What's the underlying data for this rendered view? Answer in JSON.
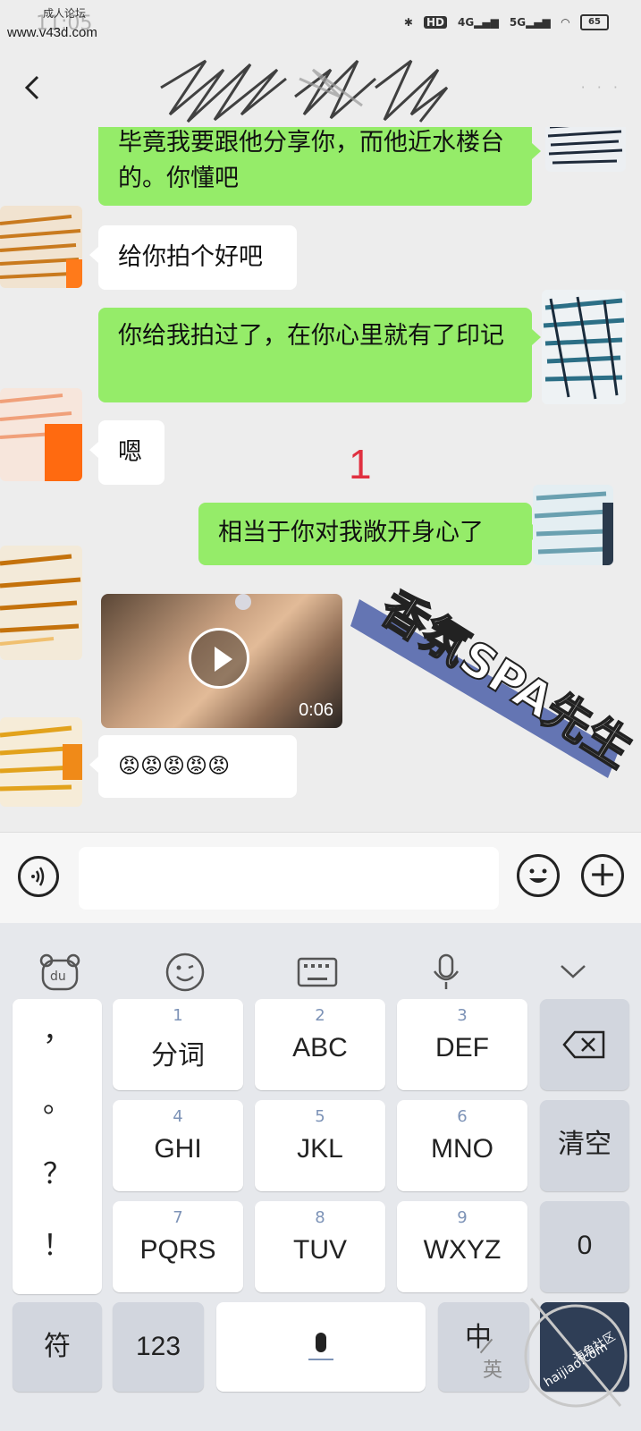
{
  "status_bar": {
    "watermark_site": "www.v43d.com",
    "watermark_forum": "成人论坛",
    "time": "11:05",
    "battery": "65"
  },
  "header": {
    "more": "· · ·"
  },
  "messages": [
    {
      "side": "mine",
      "text": "毕竟我要跟他分享你，而他近水楼台的。你懂吧"
    },
    {
      "side": "theirs",
      "text": "给你拍个好吧"
    },
    {
      "side": "mine",
      "text": "你给我拍过了，在你心里就有了印记"
    },
    {
      "side": "theirs",
      "text": "嗯"
    },
    {
      "side": "mine",
      "text": "相当于你对我敞开身心了"
    },
    {
      "side": "theirs",
      "type": "video",
      "duration": "0:06"
    },
    {
      "side": "theirs",
      "text": "😡😡😡😡😡"
    }
  ],
  "annotation_marker": "1",
  "overlay_stamp": "香氛SPA先生",
  "keyboard": {
    "toolbar": [
      "du-bear-icon",
      "emoji-face-icon",
      "keyboard-icon",
      "microphone-icon",
      "collapse-chevron-icon"
    ],
    "punctuation": [
      "，",
      "。",
      "？",
      "！"
    ],
    "keys": [
      {
        "num": "1",
        "label": "分词"
      },
      {
        "num": "2",
        "label": "ABC"
      },
      {
        "num": "3",
        "label": "DEF"
      },
      {
        "num": "4",
        "label": "GHI"
      },
      {
        "num": "5",
        "label": "JKL"
      },
      {
        "num": "6",
        "label": "MNO"
      },
      {
        "num": "7",
        "label": "PQRS"
      },
      {
        "num": "8",
        "label": "TUV"
      },
      {
        "num": "9",
        "label": "WXYZ"
      }
    ],
    "clear": "清空",
    "zero": "0",
    "symbol": "符",
    "numeric": "123",
    "lang_zh": "中",
    "lang_en": "英",
    "corner_watermark": "haijiao.com",
    "corner_watermark_cn": "海角社区"
  }
}
